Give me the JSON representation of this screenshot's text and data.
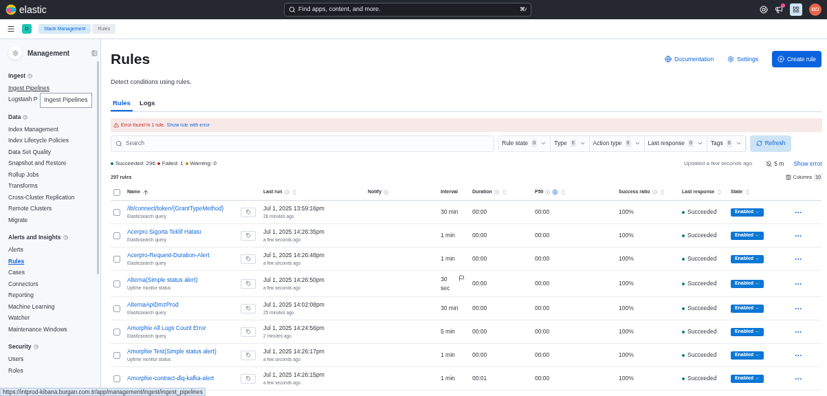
{
  "header": {
    "logo": "elastic",
    "search_placeholder": "Find apps, content, and more.",
    "shortcut": "⌘/",
    "news_badge": true,
    "avatar": "BD"
  },
  "nav": {
    "space": "D",
    "breadcrumbs": [
      {
        "label": "Stack Management",
        "selected": false
      },
      {
        "label": "Rules",
        "selected": true
      }
    ]
  },
  "sidebar": {
    "title": "Management",
    "sections": [
      {
        "title": "Ingest",
        "items": [
          {
            "label": "Ingest Pipelines",
            "selected": false,
            "hovered": true
          },
          {
            "label": "Logstash P",
            "selected": false,
            "hovered": false
          }
        ]
      },
      {
        "title": "Data",
        "items": [
          {
            "label": "Index Management",
            "selected": false,
            "hovered": false
          },
          {
            "label": "Index Lifecycle Policies",
            "selected": false,
            "hovered": false
          },
          {
            "label": "Data Set Quality",
            "selected": false,
            "hovered": false
          },
          {
            "label": "Snapshot and Restore",
            "selected": false,
            "hovered": false
          },
          {
            "label": "Rollup Jobs",
            "selected": false,
            "hovered": false
          },
          {
            "label": "Transforms",
            "selected": false,
            "hovered": false
          },
          {
            "label": "Cross-Cluster Replication",
            "selected": false,
            "hovered": false
          },
          {
            "label": "Remote Clusters",
            "selected": false,
            "hovered": false
          },
          {
            "label": "Migrate",
            "selected": false,
            "hovered": false
          }
        ]
      },
      {
        "title": "Alerts and Insights",
        "items": [
          {
            "label": "Alerts",
            "selected": false,
            "hovered": false
          },
          {
            "label": "Rules",
            "selected": true,
            "hovered": false
          },
          {
            "label": "Cases",
            "selected": false,
            "hovered": false
          },
          {
            "label": "Connectors",
            "selected": false,
            "hovered": false
          },
          {
            "label": "Reporting",
            "selected": false,
            "hovered": false
          },
          {
            "label": "Machine Learning",
            "selected": false,
            "hovered": false
          },
          {
            "label": "Watcher",
            "selected": false,
            "hovered": false
          },
          {
            "label": "Maintenance Windows",
            "selected": false,
            "hovered": false
          }
        ]
      },
      {
        "title": "Security",
        "items": [
          {
            "label": "Users",
            "selected": false,
            "hovered": false
          },
          {
            "label": "Roles",
            "selected": false,
            "hovered": false
          }
        ]
      }
    ]
  },
  "tooltip": "Ingest Pipelines",
  "page": {
    "title": "Rules",
    "description": "Detect conditions using rules.",
    "actions": [
      {
        "kind": "link",
        "label": "Documentation"
      },
      {
        "kind": "link-settings",
        "label": "Settings"
      },
      {
        "kind": "primary",
        "label": "Create rule"
      }
    ],
    "tabs": [
      {
        "label": "Rules",
        "selected": true
      },
      {
        "label": "Logs",
        "selected": false
      }
    ],
    "error_callout": {
      "text": "Error found in 1 rule.",
      "link": "Show rule with error"
    },
    "search_placeholder": "Search",
    "filters": [
      {
        "label": "Rule state",
        "count": "0"
      },
      {
        "label": "Type",
        "count": "0"
      },
      {
        "label": "Action type",
        "count": "0"
      },
      {
        "label": "Last response",
        "count": "0"
      },
      {
        "label": "Tags",
        "count": "0"
      }
    ],
    "refresh": "Refresh",
    "stats": [
      {
        "label": "Succeeded: 296",
        "color": "#007871"
      },
      {
        "label": "Failed: 1",
        "color": "#bd271e"
      },
      {
        "label": "Warning: 0",
        "color": "#b88600"
      }
    ],
    "updated": "Updated a few seconds ago",
    "snooze": "5 m",
    "show_error": "Show error",
    "count": "297 rules",
    "columns_button": {
      "label": "Columns",
      "count": "10"
    }
  },
  "table": {
    "select_all_checked": false,
    "columns": [
      {
        "label": "Name",
        "info": false,
        "sortable": true,
        "sorted": true,
        "gear": false
      },
      {
        "label": "Last run",
        "info": true,
        "sortable": true,
        "sorted": false,
        "gear": false
      },
      {
        "label": "Notify",
        "info": true,
        "sortable": false,
        "gear": false
      },
      {
        "label": "Interval",
        "info": false,
        "sortable": false,
        "gear": false
      },
      {
        "label": "Duration",
        "info": true,
        "sortable": true,
        "sorted": false,
        "gear": false
      },
      {
        "label": "P50",
        "info": true,
        "sortable": true,
        "sorted": false,
        "gear": true
      },
      {
        "label": "Success ratio",
        "info": true,
        "sortable": true,
        "sorted": false,
        "gear": false
      },
      {
        "label": "Last response",
        "info": false,
        "sortable": true,
        "sorted": false,
        "gear": false
      },
      {
        "label": "State",
        "info": false,
        "sortable": true,
        "sorted": false,
        "gear": false
      }
    ],
    "rows": [
      {
        "checked": false,
        "name": "/ib/connect/token/{GrantTypeMethod}",
        "type": "Elasticsearch query",
        "last_run": "Jul 1, 2025 13:59:16pm",
        "last_run_ago": "28 minutes ago",
        "interval": "30 min",
        "flagged": false,
        "duration": "00:00",
        "p50": "00:00",
        "success_ratio": "100%",
        "last_response": "Succeeded",
        "state": "Enabled"
      },
      {
        "checked": false,
        "name": "Acerpro Sigorta Teklif Hatası",
        "type": "Elasticsearch query",
        "last_run": "Jul 1, 2025 14:26:35pm",
        "last_run_ago": "a few seconds ago",
        "interval": "1 min",
        "flagged": false,
        "duration": "00:00",
        "p50": "00:00",
        "success_ratio": "100%",
        "last_response": "Succeeded",
        "state": "Enabled"
      },
      {
        "checked": false,
        "name": "Acerpro-Request-Duration-Alert",
        "type": "Elasticsearch query",
        "last_run": "Jul 1, 2025 14:26:48pm",
        "last_run_ago": "a few seconds ago",
        "interval": "1 min",
        "flagged": false,
        "duration": "00:00",
        "p50": "00:00",
        "success_ratio": "100%",
        "last_response": "Succeeded",
        "state": "Enabled"
      },
      {
        "checked": false,
        "name": "Alterna(Simple status alert)",
        "type": "Uptime monitor status",
        "last_run": "Jul 1, 2025 14:26:50pm",
        "last_run_ago": "a few seconds ago",
        "interval": "30 sec",
        "flagged": true,
        "duration": "00:00",
        "p50": "00:00",
        "success_ratio": "100%",
        "last_response": "Succeeded",
        "state": "Enabled"
      },
      {
        "checked": false,
        "name": "AlternaApiDmzProd",
        "type": "Elasticsearch query",
        "last_run": "Jul 1, 2025 14:02:08pm",
        "last_run_ago": "25 minutes ago",
        "interval": "30 min",
        "flagged": false,
        "duration": "00:00",
        "p50": "00:00",
        "success_ratio": "100%",
        "last_response": "Succeeded",
        "state": "Enabled"
      },
      {
        "checked": false,
        "name": "Amorphie All Logs Count Error",
        "type": "Elasticsearch query",
        "last_run": "Jul 1, 2025 14:24:56pm",
        "last_run_ago": "2 minutes ago",
        "interval": "5 min",
        "flagged": false,
        "duration": "00:00",
        "p50": "00:00",
        "success_ratio": "100%",
        "last_response": "Succeeded",
        "state": "Enabled"
      },
      {
        "checked": false,
        "name": "Amorphie Test(Simple status alert)",
        "type": "Uptime monitor status",
        "last_run": "Jul 1, 2025 14:26:17pm",
        "last_run_ago": "a few seconds ago",
        "interval": "1 min",
        "flagged": false,
        "duration": "00:00",
        "p50": "00:00",
        "success_ratio": "100%",
        "last_response": "Succeeded",
        "state": "Enabled"
      },
      {
        "checked": false,
        "name": "Amorphie-contract-dlq-kafka-alert",
        "last_run": "Jul 1, 2025 14:26:15pm",
        "last_run_ago": "a few seconds ago",
        "interval": "1 min",
        "flagged": false,
        "duration": "00:01",
        "p50": "00:00",
        "success_ratio": "100%",
        "last_response": "Succeeded",
        "state": "Enabled"
      }
    ]
  },
  "status_url": "https://intprod-kibana.burgan.com.tr/app/management/ingest/ingest_pipelines"
}
